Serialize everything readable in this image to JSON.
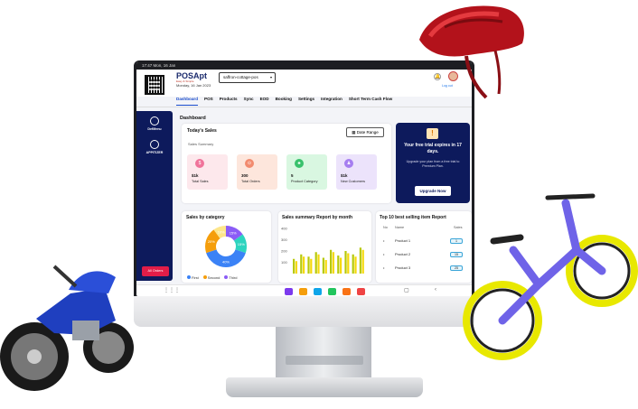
{
  "status": {
    "time_date": "17:47  Mon, 16 Jan"
  },
  "header": {
    "brand": "POSApt",
    "brand_tagline": "Easy & Simple",
    "date": "Monday, 16 Jan 2023",
    "store_selected": "saffron-cottage-pos",
    "logout": "Log out"
  },
  "nav": {
    "items": [
      "Dashboard",
      "POS",
      "Products",
      "Sync",
      "EOD",
      "Booking",
      "Settings",
      "Integration",
      "Short Term Cash Flow"
    ]
  },
  "sidebar": {
    "items": [
      "DefMenu",
      "APPITIZER"
    ],
    "all_orders": "All Orders"
  },
  "page": {
    "title": "Dashboard"
  },
  "sales": {
    "title": "Today's Sales",
    "date_range": "Date Range",
    "summary_label": "Sales Summary",
    "tiles": [
      {
        "value": "$1k",
        "label": "Total Sales",
        "bg": "#fde8ec",
        "accent": "#f0739a"
      },
      {
        "value": "300",
        "label": "Total Orders",
        "bg": "#fde6dc",
        "accent": "#f28b6f"
      },
      {
        "value": "5",
        "label": "Product Category",
        "bg": "#d9f7e1",
        "accent": "#39c16c"
      },
      {
        "value": "$1k",
        "label": "New Customers",
        "bg": "#ece3fb",
        "accent": "#a67ef0"
      }
    ]
  },
  "trial": {
    "title": "Your free trial expires in 17 days.",
    "text": "Upgrade your plan from a free trial to Premium Plan.",
    "button": "Upgrade Now"
  },
  "category": {
    "title": "Sales by category",
    "legend": [
      "First",
      "Second",
      "Third"
    ],
    "slices": [
      {
        "label": "15%",
        "value": 15,
        "color": "#8b5cf6"
      },
      {
        "label": "15%",
        "value": 15,
        "color": "#2dd4bf"
      },
      {
        "label": "40%",
        "value": 40,
        "color": "#3b82f6"
      },
      {
        "label": "20%",
        "value": 20,
        "color": "#f59e0b"
      },
      {
        "label": "10%",
        "value": 10,
        "color": "#fde68a"
      }
    ]
  },
  "report": {
    "title": "Sales summary Report by month",
    "y_ticks": [
      "400",
      "300",
      "200",
      "100"
    ]
  },
  "chart_data": {
    "type": "bar",
    "title": "Sales summary Report by month",
    "series": [
      {
        "values": [
          130,
          170,
          150,
          190,
          140,
          210,
          160,
          200,
          170,
          230
        ]
      },
      {
        "values": [
          110,
          150,
          130,
          170,
          120,
          190,
          140,
          180,
          150,
          210
        ]
      }
    ],
    "ylim": [
      0,
      400
    ],
    "colors": [
      "#b7c90a",
      "#f5d90a"
    ]
  },
  "top_items": {
    "title": "Top 10 best selling item Report",
    "col_no": "No",
    "col_name": "Name",
    "col_sales": "Sales",
    "rows": [
      {
        "name": "Product 1",
        "sales": "1"
      },
      {
        "name": "Product 2",
        "sales": "15"
      },
      {
        "name": "Product 3",
        "sales": "25"
      }
    ]
  }
}
